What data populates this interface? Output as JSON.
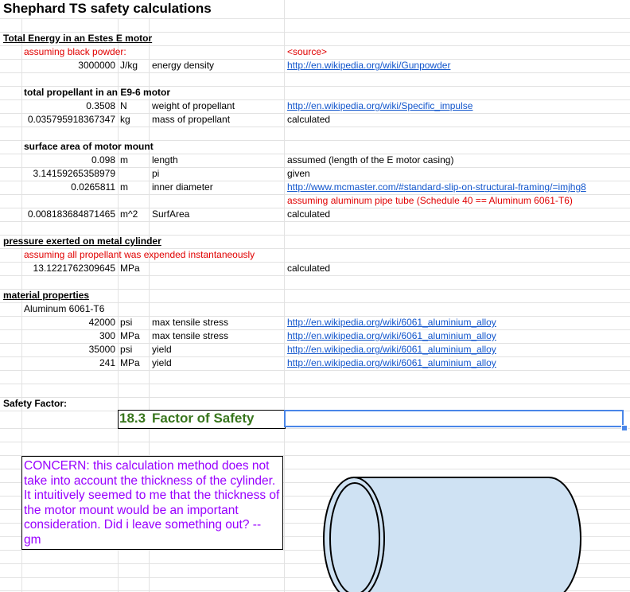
{
  "title": "Shephard TS safety calculations",
  "energy": {
    "header": "Total Energy in an Estes E motor",
    "note": "assuming black powder:",
    "source_header": "<source>",
    "value": "3000000",
    "unit": "J/kg",
    "label": "energy density",
    "source": "http://en.wikipedia.org/wiki/Gunpowder"
  },
  "propellant": {
    "header": "total propellant in an E9-6 motor",
    "rows": [
      {
        "value": "0.3508",
        "unit": "N",
        "label": "weight of propellant",
        "source": "http://en.wikipedia.org/wiki/Specific_impulse"
      },
      {
        "value": "0.035795918367347",
        "unit": "kg",
        "label": "mass of propellant",
        "source": "calculated"
      }
    ]
  },
  "surface": {
    "header": "surface area of motor mount",
    "rows": [
      {
        "value": "0.098",
        "unit": "m",
        "label": "length",
        "source": "assumed (length of the E motor casing)"
      },
      {
        "value": "3.14159265358979",
        "unit": "",
        "label": "pi",
        "source": "given"
      },
      {
        "value": "0.0265811",
        "unit": "m",
        "label": "inner diameter",
        "source": "http://www.mcmaster.com/#standard-slip-on-structural-framing/=imjhg8"
      }
    ],
    "assumption": "assuming aluminum pipe tube (Schedule 40 == Aluminum 6061-T6)",
    "area": {
      "value": "0.008183684871465",
      "unit": "m^2",
      "label": "SurfArea",
      "source": "calculated"
    }
  },
  "pressure": {
    "header": "pressure exerted on metal cylinder",
    "note": "assuming all propellant was expended instantaneously",
    "value": "13.1221762309645",
    "unit": "MPa",
    "source": "calculated"
  },
  "material": {
    "header": "material properties",
    "name": "Aluminum 6061-T6",
    "rows": [
      {
        "value": "42000",
        "unit": "psi",
        "label": "max tensile stress",
        "source": "http://en.wikipedia.org/wiki/6061_aluminium_alloy"
      },
      {
        "value": "300",
        "unit": "MPa",
        "label": "max tensile stress",
        "source": "http://en.wikipedia.org/wiki/6061_aluminium_alloy"
      },
      {
        "value": "35000",
        "unit": "psi",
        "label": "yield",
        "source": "http://en.wikipedia.org/wiki/6061_aluminium_alloy"
      },
      {
        "value": "241",
        "unit": "MPa",
        "label": "yield",
        "source": "http://en.wikipedia.org/wiki/6061_aluminium_alloy"
      }
    ]
  },
  "safety": {
    "header": "Safety Factor:",
    "value": "18.3",
    "label": "Factor of Safety"
  },
  "concern": "CONCERN: this calculation method does not take into account the thickness of the cylinder. It intuitively seemed to me that the thickness of the motor mount would be an important consideration. Did i leave something out? -- gm",
  "colors": {
    "link": "#1155cc",
    "note_red": "#e00000",
    "safety_green": "#38761d",
    "concern_purple": "#9900ff",
    "cylinder_fill": "#cfe2f3",
    "selection": "#4a86e8"
  }
}
